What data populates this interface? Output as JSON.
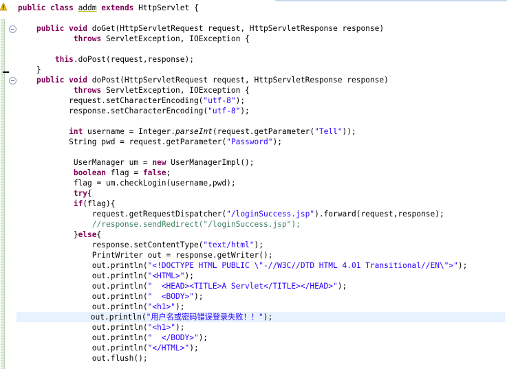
{
  "editor": {
    "language": "Java",
    "lines": [
      [
        {
          "t": "public class ",
          "s": "kw"
        },
        {
          "t": "addm",
          "s": "ul"
        },
        {
          "t": " "
        },
        {
          "t": "extends",
          "s": "kw"
        },
        {
          "t": " HttpServlet {"
        }
      ],
      [],
      [
        {
          "t": "    "
        },
        {
          "t": "public void",
          "s": "kw"
        },
        {
          "t": " doGet(HttpServletRequest request, HttpServletResponse response)"
        }
      ],
      [
        {
          "t": "            "
        },
        {
          "t": "throws",
          "s": "kw"
        },
        {
          "t": " ServletException, IOException {"
        }
      ],
      [],
      [
        {
          "t": "        "
        },
        {
          "t": "this",
          "s": "kw"
        },
        {
          "t": ".doPost(request,response);"
        }
      ],
      [
        {
          "t": "    }"
        }
      ],
      [
        {
          "t": "    "
        },
        {
          "t": "public void",
          "s": "kw"
        },
        {
          "t": " doPost(HttpServletRequest request, HttpServletResponse response)"
        }
      ],
      [
        {
          "t": "            "
        },
        {
          "t": "throws",
          "s": "kw"
        },
        {
          "t": " ServletException, IOException {"
        }
      ],
      [
        {
          "t": "           request.setCharacterEncoding("
        },
        {
          "t": "\"utf-8\"",
          "s": "str"
        },
        {
          "t": ");"
        }
      ],
      [
        {
          "t": "           response.setCharacterEncoding("
        },
        {
          "t": "\"utf-8\"",
          "s": "str"
        },
        {
          "t": ");"
        }
      ],
      [],
      [
        {
          "t": "           "
        },
        {
          "t": "int",
          "s": "kw"
        },
        {
          "t": " username = Integer."
        },
        {
          "t": "parseInt",
          "s": "it"
        },
        {
          "t": "(request.getParameter("
        },
        {
          "t": "\"Tell\"",
          "s": "str"
        },
        {
          "t": "));"
        }
      ],
      [
        {
          "t": "           String pwd = request.getParameter("
        },
        {
          "t": "\"Password\"",
          "s": "str"
        },
        {
          "t": ");"
        }
      ],
      [],
      [
        {
          "t": "            UserManager um = "
        },
        {
          "t": "new",
          "s": "kw"
        },
        {
          "t": " UserManagerImpl();"
        }
      ],
      [
        {
          "t": "            "
        },
        {
          "t": "boolean",
          "s": "kw"
        },
        {
          "t": " flag = "
        },
        {
          "t": "false",
          "s": "kw"
        },
        {
          "t": ";"
        }
      ],
      [
        {
          "t": "            flag = um.checkLogin(username,pwd);"
        }
      ],
      [
        {
          "t": "            "
        },
        {
          "t": "try",
          "s": "kw"
        },
        {
          "t": "{"
        }
      ],
      [
        {
          "t": "            "
        },
        {
          "t": "if",
          "s": "kw"
        },
        {
          "t": "(flag){"
        }
      ],
      [
        {
          "t": "                request.getRequestDispatcher("
        },
        {
          "t": "\"/loginSuccess.jsp\"",
          "s": "str"
        },
        {
          "t": ").forward(request,response);"
        }
      ],
      [
        {
          "t": "                "
        },
        {
          "t": "//response.sendRedirect(\"/loginSuccess.jsp\");",
          "s": "cmt"
        }
      ],
      [
        {
          "t": "            }"
        },
        {
          "t": "else",
          "s": "kw"
        },
        {
          "t": "{"
        }
      ],
      [
        {
          "t": "                response.setContentType("
        },
        {
          "t": "\"text/html\"",
          "s": "str"
        },
        {
          "t": ");"
        }
      ],
      [
        {
          "t": "                PrintWriter out = response.getWriter();"
        }
      ],
      [
        {
          "t": "                out.println("
        },
        {
          "t": "\"<!DOCTYPE HTML PUBLIC \\\"-//W3C//DTD HTML 4.01 Transitional//EN\\\">\"",
          "s": "str"
        },
        {
          "t": ");"
        }
      ],
      [
        {
          "t": "                out.println("
        },
        {
          "t": "\"<HTML>\"",
          "s": "str"
        },
        {
          "t": ");"
        }
      ],
      [
        {
          "t": "                out.println("
        },
        {
          "t": "\"  <HEAD><TITLE>A Servlet</TITLE></HEAD>\"",
          "s": "str"
        },
        {
          "t": ");"
        }
      ],
      [
        {
          "t": "                out.println("
        },
        {
          "t": "\"  <BODY>\"",
          "s": "str"
        },
        {
          "t": ");"
        }
      ],
      [
        {
          "t": "                out.println("
        },
        {
          "t": "\"<h1>\"",
          "s": "str"
        },
        {
          "t": ");"
        }
      ],
      [
        {
          "t": "                out.println("
        },
        {
          "t": "\"用户名或密码错误登录失败！！\"",
          "s": "str"
        },
        {
          "t": ");"
        }
      ],
      [
        {
          "t": "                out.println("
        },
        {
          "t": "\"<h1>\"",
          "s": "str"
        },
        {
          "t": ");"
        }
      ],
      [
        {
          "t": "                out.println("
        },
        {
          "t": "\"  </BODY>\"",
          "s": "str"
        },
        {
          "t": ");"
        }
      ],
      [
        {
          "t": "                out.println("
        },
        {
          "t": "\"</HTML>\"",
          "s": "str"
        },
        {
          "t": ");"
        }
      ],
      [
        {
          "t": "                out.flush();"
        }
      ]
    ],
    "current_line": 30,
    "fold_markers": [
      2,
      7
    ],
    "colors": {
      "keyword": "#7f0055",
      "string": "#2a00ff",
      "comment": "#3f7f5f",
      "current_line_bg": "#e8f2fe"
    }
  },
  "icons": {
    "warning": "warning-icon",
    "fold": "fold-collapse-icon"
  }
}
